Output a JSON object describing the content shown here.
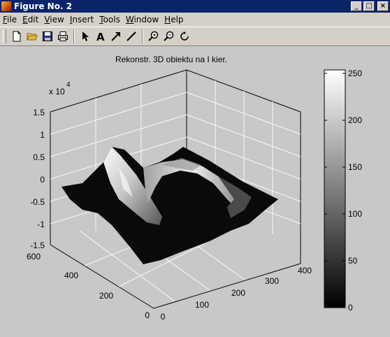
{
  "window": {
    "title": "Figure No. 2",
    "min_label": "_",
    "max_label": "□",
    "close_label": "×"
  },
  "menu": [
    {
      "label": "File",
      "u": "F"
    },
    {
      "label": "Edit",
      "u": "E"
    },
    {
      "label": "View",
      "u": "V"
    },
    {
      "label": "Insert",
      "u": "I"
    },
    {
      "label": "Tools",
      "u": "T"
    },
    {
      "label": "Window",
      "u": "W"
    },
    {
      "label": "Help",
      "u": "H"
    }
  ],
  "toolbar": {
    "buttons": [
      "new-file-icon",
      "open-folder-icon",
      "save-icon",
      "print-icon",
      "pointer-arrow-icon",
      "insert-text-icon",
      "insert-arrow-icon",
      "insert-line-icon",
      "zoom-in-icon",
      "zoom-out-icon",
      "rotate-3d-icon"
    ]
  },
  "plot": {
    "title": "Rekonstr. 3D  obiektu na I kier.",
    "z_exponent_base": "x 10",
    "z_exponent_power": "4",
    "z_ticks": [
      "1.5",
      "1",
      "0.5",
      "0",
      "-0.5",
      "-1",
      "-1.5"
    ],
    "y_ticks": [
      "600",
      "400",
      "200",
      "0"
    ],
    "x_ticks": [
      "0",
      "100",
      "200",
      "300",
      "400"
    ],
    "colorbar_ticks": [
      "250",
      "200",
      "150",
      "100",
      "50",
      "0"
    ]
  }
}
